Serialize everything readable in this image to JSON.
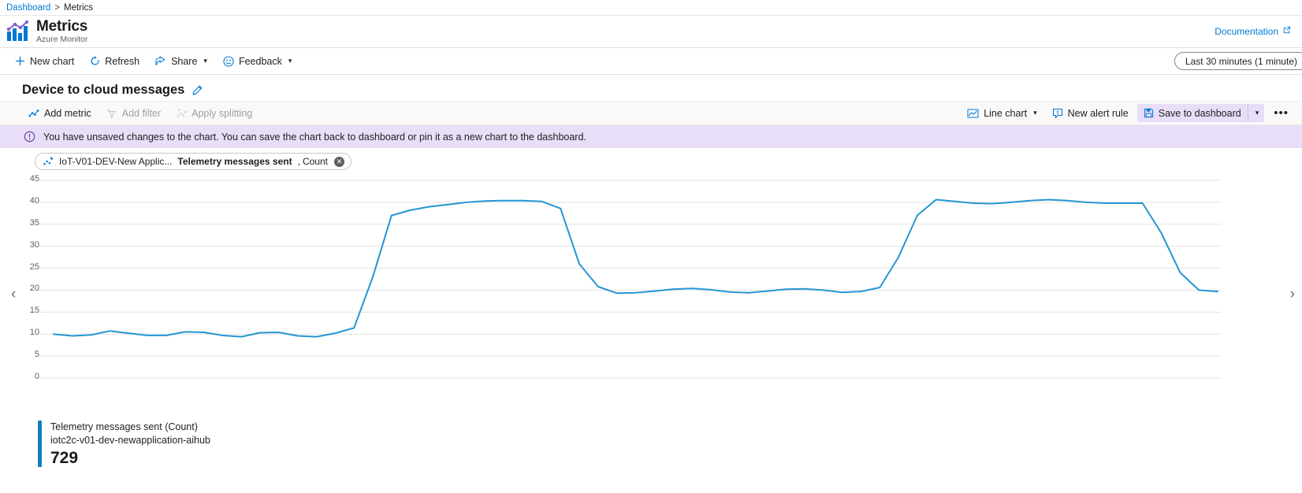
{
  "breadcrumb": {
    "root": "Dashboard",
    "separator": ">",
    "current": "Metrics"
  },
  "header": {
    "title": "Metrics",
    "subtitle": "Azure Monitor",
    "documentation_label": "Documentation",
    "documentation_icon": "external-link-icon",
    "app_icon": "metrics-bar-chart-icon"
  },
  "command_bar": {
    "new_chart": "New chart",
    "new_chart_icon": "plus-icon",
    "refresh": "Refresh",
    "refresh_icon": "refresh-icon",
    "share": "Share",
    "share_icon": "share-icon",
    "feedback": "Feedback",
    "feedback_icon": "smiley-icon",
    "chevron": "⌵",
    "time_range": "Last 30 minutes (1 minute)"
  },
  "chart_header": {
    "title": "Device to cloud messages",
    "edit_icon": "pencil-icon"
  },
  "chart_toolbar": {
    "add_metric": "Add metric",
    "add_metric_icon": "add-metric-icon",
    "add_filter": "Add filter",
    "add_filter_icon": "filter-icon",
    "apply_splitting": "Apply splitting",
    "apply_splitting_icon": "splitting-icon",
    "chart_type": "Line chart",
    "chart_type_icon": "line-chart-icon",
    "new_alert_rule": "New alert rule",
    "new_alert_rule_icon": "alert-icon",
    "save_to_dashboard": "Save to dashboard",
    "save_icon": "save-disk-icon",
    "more_label": "•••"
  },
  "info_banner": {
    "icon": "info-exclamation-icon",
    "message": "You have unsaved changes to the chart. You can save the chart back to dashboard or pin it as a new chart to the dashboard."
  },
  "metric_pill": {
    "icon": "metric-scatter-icon",
    "scope": "IoT-V01-DEV-New Applic...",
    "metric": "Telemetry messages sent",
    "separator": ",",
    "aggregation": "Count",
    "remove_icon": "close-circle-icon"
  },
  "navigation": {
    "prev_icon": "chevron-left-icon",
    "next_icon": "chevron-right-icon"
  },
  "legend": {
    "series_label": "Telemetry messages sent (Count)",
    "resource": "iotc2c-v01-dev-newapplication-aihub",
    "value": "729",
    "color": "#0f7fc1"
  },
  "chart_data": {
    "type": "line",
    "title": "Device to cloud messages",
    "xlabel": "",
    "ylabel": "",
    "ylim": [
      0,
      47
    ],
    "yticks": [
      45,
      40,
      35,
      30,
      25,
      20,
      15,
      10,
      5,
      0
    ],
    "grid": true,
    "legend_position": "bottom-left",
    "line_color": "#2496d4",
    "series": [
      {
        "name": "Telemetry messages sent (Count)",
        "resource": "iotc2c-v01-dev-newapplication-aihub",
        "total": 729,
        "values": [
          10.0,
          9.6,
          9.8,
          10.7,
          10.2,
          9.7,
          9.7,
          10.5,
          10.4,
          9.7,
          9.4,
          10.3,
          10.4,
          9.6,
          9.4,
          10.2,
          11.4,
          23.0,
          37.0,
          38.2,
          39.0,
          39.5,
          40.0,
          40.3,
          40.4,
          40.4,
          40.2,
          38.6,
          26.0,
          20.8,
          19.3,
          19.4,
          19.8,
          20.2,
          20.4,
          20.1,
          19.6,
          19.4,
          19.8,
          20.2,
          20.3,
          20.0,
          19.5,
          19.7,
          20.6,
          27.5,
          37.0,
          40.6,
          40.2,
          39.8,
          39.7,
          40.0,
          40.4,
          40.6,
          40.4,
          40.0,
          39.8,
          39.8,
          39.8,
          33.0,
          24.0,
          20.0,
          19.7
        ]
      }
    ]
  }
}
